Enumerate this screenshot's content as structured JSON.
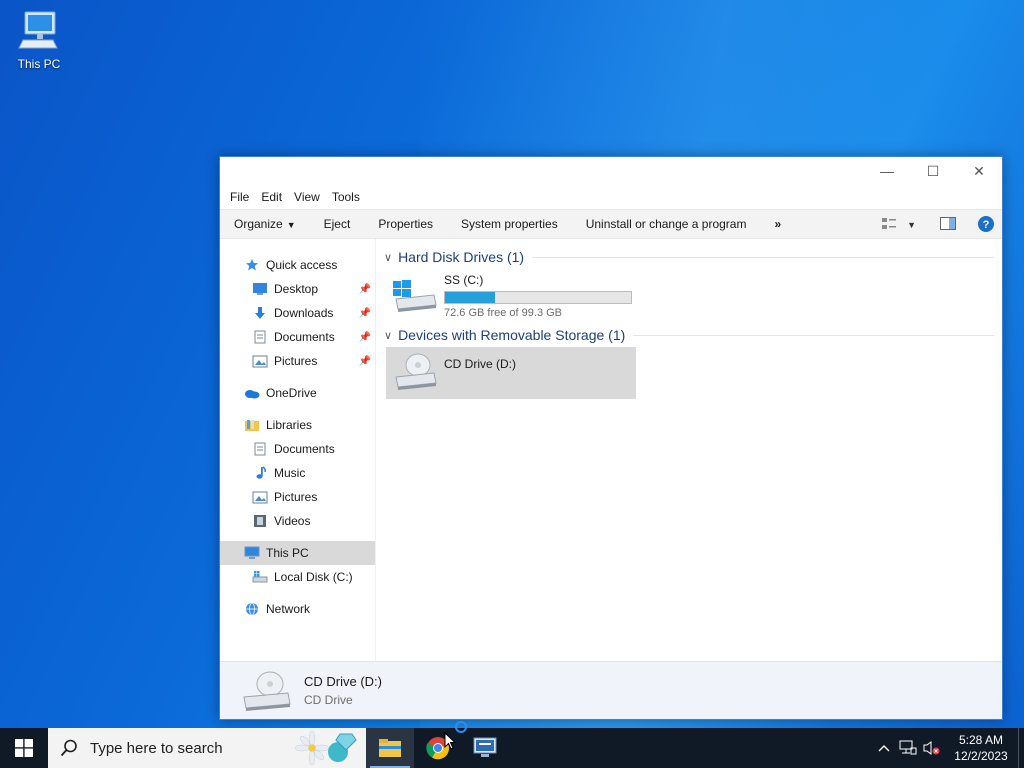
{
  "desktop": {
    "icon_label": "This PC"
  },
  "window": {
    "controls": {
      "minimize": "—",
      "maximize": "☐",
      "close": "✕"
    },
    "menu": [
      "File",
      "Edit",
      "View",
      "Tools"
    ],
    "commands": {
      "organize": "Organize",
      "eject": "Eject",
      "properties": "Properties",
      "system_properties": "System properties",
      "uninstall": "Uninstall or change a program",
      "more": "»"
    },
    "nav": {
      "quick_access": "Quick access",
      "desktop": "Desktop",
      "downloads": "Downloads",
      "documents": "Documents",
      "pictures": "Pictures",
      "onedrive": "OneDrive",
      "libraries": "Libraries",
      "lib_documents": "Documents",
      "lib_music": "Music",
      "lib_pictures": "Pictures",
      "lib_videos": "Videos",
      "this_pc": "This PC",
      "local_disk": "Local Disk (C:)",
      "network": "Network"
    },
    "groups": {
      "hdd": "Hard Disk Drives (1)",
      "removable": "Devices with Removable Storage (1)"
    },
    "drives": {
      "c": {
        "name": "SS (C:)",
        "free_text": "72.6 GB free of 99.3 GB",
        "used_fraction": 0.269
      },
      "d": {
        "name": "CD Drive (D:)"
      }
    },
    "details": {
      "name": "CD Drive (D:)",
      "type": "CD Drive"
    }
  },
  "taskbar": {
    "search_placeholder": "Type here to search",
    "time": "5:28 AM",
    "date": "12/2/2023"
  },
  "colors": {
    "accent": "#26a0da",
    "taskbar": "#101a27",
    "selection": "#d9d9d9"
  }
}
